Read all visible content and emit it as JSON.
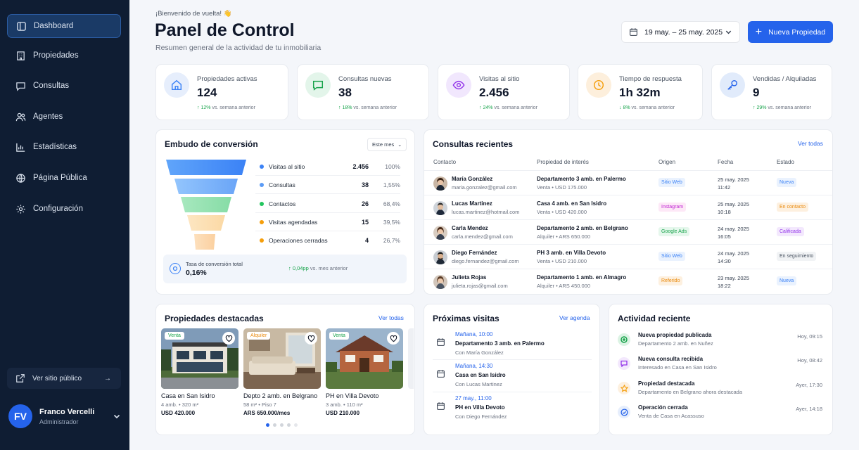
{
  "sidebar": {
    "items": [
      {
        "label": "Dashboard",
        "icon": "dashboard-icon",
        "active": true
      },
      {
        "label": "Propiedades",
        "icon": "building-icon"
      },
      {
        "label": "Consultas",
        "icon": "chat-icon"
      },
      {
        "label": "Agentes",
        "icon": "users-icon"
      },
      {
        "label": "Estadísticas",
        "icon": "bar-chart-icon"
      },
      {
        "label": "Página Pública",
        "icon": "globe-icon"
      },
      {
        "label": "Configuración",
        "icon": "gear-icon"
      }
    ],
    "public_link": "Ver sitio público",
    "user": {
      "initials": "FV",
      "name": "Franco Vercelli",
      "role": "Administrador"
    }
  },
  "header": {
    "welcome": "¡Bienvenido de vuelta! 👋",
    "title": "Panel de Control",
    "subtitle": "Resumen general de la actividad de tu inmobiliaria",
    "date_range": "19 may. – 25 may. 2025",
    "new_button": "Nueva Propiedad"
  },
  "stats": [
    {
      "label": "Propiedades activas",
      "value": "124",
      "change": "↑ 12%",
      "suffix": "vs. semana anterior",
      "color": "#3b82f6",
      "bg": "#e6eefc"
    },
    {
      "label": "Consultas nuevas",
      "value": "38",
      "change": "↑ 18%",
      "suffix": "vs. semana anterior",
      "color": "#16a34a",
      "bg": "#e3f5ea"
    },
    {
      "label": "Visitas al sitio",
      "value": "2.456",
      "change": "↑ 24%",
      "suffix": "vs. semana anterior",
      "color": "#9333ea",
      "bg": "#f1e7fd"
    },
    {
      "label": "Tiempo de respuesta",
      "value": "1h 32m",
      "change": "↓ 8%",
      "suffix": "vs. semana anterior",
      "color": "#f59e0b",
      "bg": "#fdefdc"
    },
    {
      "label": "Vendidas / Alquiladas",
      "value": "9",
      "change": "↑ 29%",
      "suffix": "vs. semana anterior",
      "color": "#2563eb",
      "bg": "#e1ebfb"
    }
  ],
  "funnel": {
    "title": "Embudo de conversión",
    "period": "Este mes",
    "rows": [
      {
        "label": "Visitas al sitio",
        "value": "2.456",
        "pct": "100%",
        "color": "#3b82f6"
      },
      {
        "label": "Consultas",
        "value": "38",
        "pct": "1,55%",
        "color": "#5b9bf6"
      },
      {
        "label": "Contactos",
        "value": "26",
        "pct": "68,4%",
        "color": "#22c55e"
      },
      {
        "label": "Visitas agendadas",
        "value": "15",
        "pct": "39,5%",
        "color": "#f59e0b"
      },
      {
        "label": "Operaciones cerradas",
        "value": "4",
        "pct": "26,7%",
        "color": "#f59e0b"
      }
    ],
    "conversion_label": "Tasa de conversión total",
    "conversion_value": "0,16%",
    "conversion_change": "↑ 0,04pp",
    "conversion_suffix": "vs. mes anterior"
  },
  "inquiries": {
    "title": "Consultas recientes",
    "view_all": "Ver todas",
    "headers": [
      "Contacto",
      "Propiedad de interés",
      "Origen",
      "Fecha",
      "Estado"
    ],
    "rows": [
      {
        "name": "María González",
        "email": "maria.gonzalez@gmail.com",
        "property": "Departamento 3 amb. en Palermo",
        "detail": "Venta • USD 175.000",
        "origin": "Sitio Web",
        "date": "25 may. 2025",
        "time": "11:42",
        "status": "Nueva"
      },
      {
        "name": "Lucas Martinez",
        "email": "lucas.martinez@hotmail.com",
        "property": "Casa 4 amb. en San Isidro",
        "detail": "Venta • USD 420.000",
        "origin": "Instagram",
        "date": "25 may. 2025",
        "time": "10:18",
        "status": "En contacto"
      },
      {
        "name": "Carla Mendez",
        "email": "carla.mendez@gmail.com",
        "property": "Departamento 2 amb. en Belgrano",
        "detail": "Alquiler • ARS 650.000",
        "origin": "Google Ads",
        "date": "24 may. 2025",
        "time": "16:05",
        "status": "Calificada"
      },
      {
        "name": "Diego Fernández",
        "email": "diego.fernandez@gmail.com",
        "property": "PH 3 amb. en Villa Devoto",
        "detail": "Venta • USD 210.000",
        "origin": "Sitio Web",
        "date": "24 may. 2025",
        "time": "14:30",
        "status": "En seguimiento"
      },
      {
        "name": "Julieta Rojas",
        "email": "julieta.rojas@gmail.com",
        "property": "Departamento 1 amb. en Almagro",
        "detail": "Alquiler • ARS 450.000",
        "origin": "Referido",
        "date": "23 may. 2025",
        "time": "18:22",
        "status": "Nueva"
      }
    ]
  },
  "featured": {
    "title": "Propiedades destacadas",
    "view_all": "Ver todas",
    "items": [
      {
        "badge": "Venta",
        "name": "Casa en San Isidro",
        "detail": "4 amb. • 320 m²",
        "price": "USD 420.000"
      },
      {
        "badge": "Alquiler",
        "name": "Depto 2 amb. en Belgrano",
        "detail": "58 m² • Piso 7",
        "price": "ARS 650.000/mes"
      },
      {
        "badge": "Venta",
        "name": "PH en Villa Devoto",
        "detail": "3 amb. • 110 m²",
        "price": "USD 210.000"
      }
    ]
  },
  "visits": {
    "title": "Próximas visitas",
    "view_all": "Ver agenda",
    "items": [
      {
        "time": "Mañana, 10:00",
        "property": "Departamento 3 amb. en Palermo",
        "contact": "Con María González"
      },
      {
        "time": "Mañana, 14:30",
        "property": "Casa en San Isidro",
        "contact": "Con Lucas Martinez"
      },
      {
        "time": "27 may., 11:00",
        "property": "PH en Villa Devoto",
        "contact": "Con Diego Fernández"
      }
    ]
  },
  "activity": {
    "title": "Actividad reciente",
    "items": [
      {
        "title": "Nueva propiedad publicada",
        "desc": "Departamento 2 amb. en Nuñez",
        "time": "Hoy, 09:15"
      },
      {
        "title": "Nueva consulta recibida",
        "desc": "Interesado en Casa en San Isidro",
        "time": "Hoy, 08:42"
      },
      {
        "title": "Propiedad destacada",
        "desc": "Departamento en Belgrano ahora destacada",
        "time": "Ayer, 17:30"
      },
      {
        "title": "Operación cerrada",
        "desc": "Venta de Casa en Acassuso",
        "time": "Ayer, 14:18"
      }
    ]
  }
}
